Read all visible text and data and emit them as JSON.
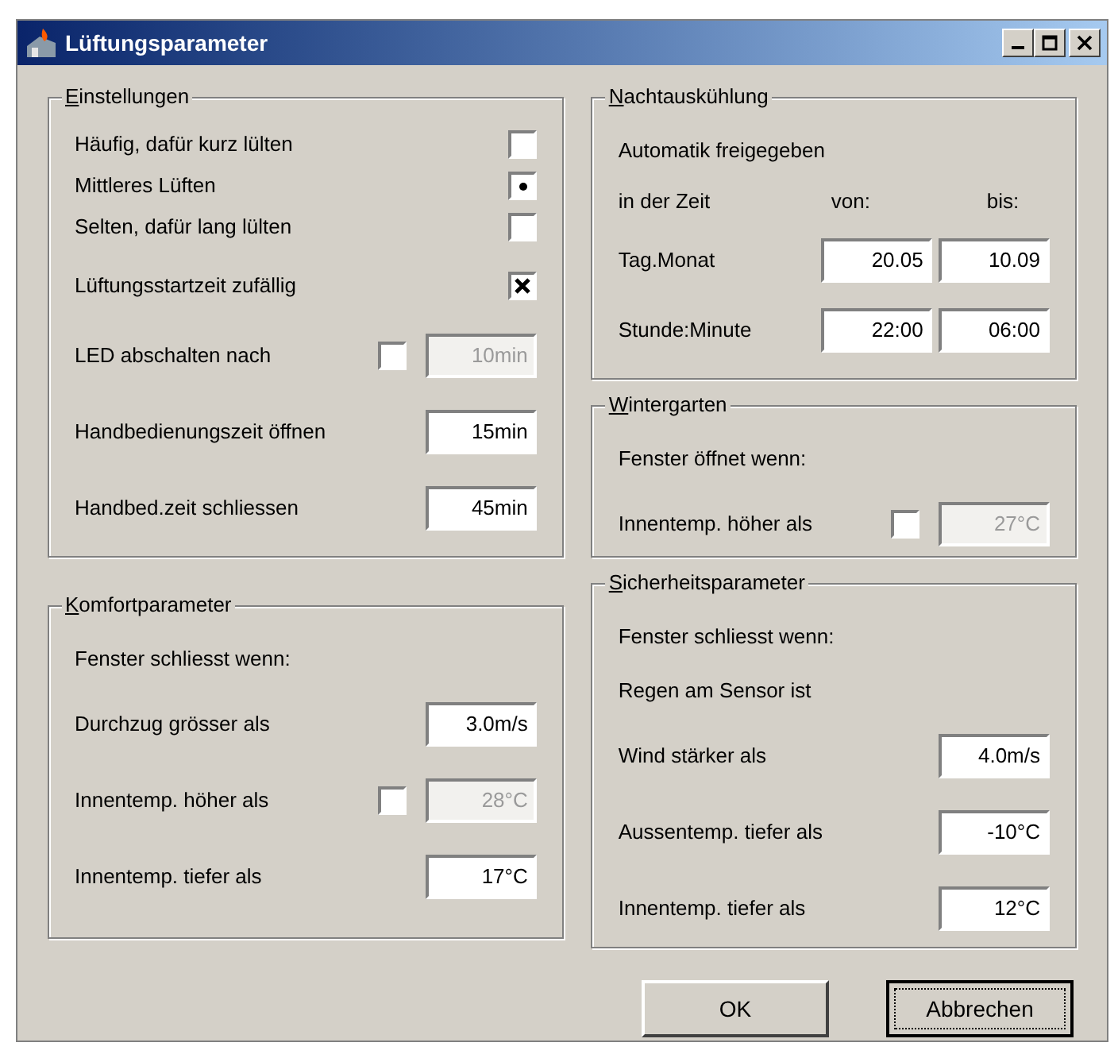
{
  "window": {
    "title": "Lüftungsparameter"
  },
  "left": [
    {
      "title": "Einstellungen",
      "rows": [
        {
          "kind": "radio",
          "label": "Häufig, dafür kurz lülten",
          "selected": false
        },
        {
          "kind": "radio",
          "label": "Mittleres Lüften",
          "selected": true
        },
        {
          "kind": "radio",
          "label": "Selten, dafür lang lülten",
          "selected": false
        },
        {
          "kind": "checkbox",
          "label": "Lüftungsstartzeit zufällig",
          "checked": true
        },
        {
          "kind": "check_field",
          "label": "LED abschalten nach",
          "checked": false,
          "value": "10min"
        },
        {
          "kind": "field",
          "label": "Handbedienungszeit öffnen",
          "value": "15min"
        },
        {
          "kind": "field",
          "label": "Handbed.zeit schliessen",
          "value": "45min"
        }
      ]
    },
    {
      "title": "Komfortparameter",
      "rows": [
        {
          "kind": "text",
          "label": "Fenster schliesst wenn:"
        },
        {
          "kind": "field",
          "label": "Durchzug grösser als",
          "value": "3.0m/s"
        },
        {
          "kind": "check_field",
          "label": "Innentemp. höher als",
          "checked": false,
          "value": "28°C"
        },
        {
          "kind": "field",
          "label": "Innentemp. tiefer als",
          "value": "17°C"
        }
      ]
    }
  ],
  "right": [
    {
      "title": "Nachtauskühlung",
      "rows": [
        {
          "kind": "text",
          "label": "Automatik freigegeben"
        },
        {
          "kind": "header",
          "label": "in der Zeit",
          "from": "von:",
          "to": "bis:"
        },
        {
          "kind": "pair",
          "label": "Tag.Monat",
          "from": "20.05",
          "to": "10.09"
        },
        {
          "kind": "pair",
          "label": "Stunde:Minute",
          "from": "22:00",
          "to": "06:00"
        }
      ]
    },
    {
      "title": "Wintergarten",
      "rows": [
        {
          "kind": "text",
          "label": "Fenster öffnet wenn:"
        },
        {
          "kind": "check_field",
          "label": "Innentemp. höher als",
          "checked": false,
          "value": "27°C"
        }
      ]
    },
    {
      "title": "Sicherheitsparameter",
      "rows": [
        {
          "kind": "text",
          "label": "Fenster schliesst wenn:"
        },
        {
          "kind": "text",
          "label": "Regen am Sensor ist"
        },
        {
          "kind": "field",
          "label": "Wind stärker als",
          "value": "4.0m/s"
        },
        {
          "kind": "field",
          "label": "Aussentemp. tiefer als",
          "value": "-10°C"
        },
        {
          "kind": "field",
          "label": "Innentemp. tiefer als",
          "value": "12°C"
        }
      ]
    }
  ],
  "buttons": [
    {
      "label": "OK",
      "focused": false
    },
    {
      "label": "Abbrechen",
      "focused": true
    }
  ]
}
